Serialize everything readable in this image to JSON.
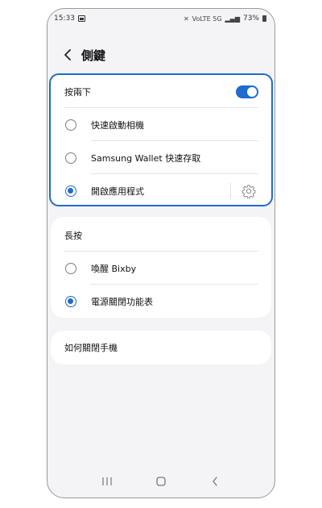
{
  "status_bar": {
    "time": "15:33",
    "network": "VoLTE 5G",
    "battery_percent": "73%"
  },
  "header": {
    "title": "側鍵"
  },
  "double_press": {
    "label": "按兩下",
    "enabled": true,
    "options": [
      {
        "label": "快速啟動相機",
        "selected": false
      },
      {
        "label": "Samsung Wallet 快速存取",
        "selected": false
      },
      {
        "label": "開啟應用程式",
        "selected": true
      }
    ]
  },
  "long_press": {
    "label": "長按",
    "options": [
      {
        "label": "喚醒 Bixby",
        "selected": false
      },
      {
        "label": "電源關閉功能表",
        "selected": true
      }
    ]
  },
  "how_to_power_off": {
    "label": "如何關閉手機"
  },
  "colors": {
    "accent": "#1f6bd0",
    "background": "#f4f4f6",
    "card": "#ffffff"
  }
}
